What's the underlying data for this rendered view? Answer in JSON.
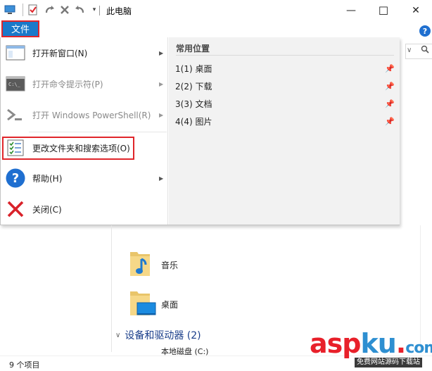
{
  "window": {
    "title": "此电脑",
    "controls": {
      "minimize": "—",
      "maximize": "☐",
      "close": "✕"
    }
  },
  "quick_access": {
    "icons": [
      "computer-icon",
      "properties-icon",
      "redo-icon",
      "delete-icon",
      "undo-icon",
      "customize-dropdown-icon"
    ]
  },
  "ribbon": {
    "file_tab_label": "文件",
    "help_glyph": "?"
  },
  "file_menu": {
    "items": [
      {
        "label": "打开新窗口(N)",
        "icon": "new-window-icon",
        "submenu": true,
        "disabled": false
      },
      {
        "label": "打开命令提示符(P)",
        "icon": "command-prompt-icon",
        "submenu": true,
        "disabled": true
      },
      {
        "label": "打开 Windows PowerShell(R)",
        "icon": "powershell-icon",
        "submenu": true,
        "disabled": true
      },
      {
        "label": "更改文件夹和搜索选项(O)",
        "icon": "folder-options-icon",
        "submenu": false,
        "disabled": false
      },
      {
        "label": "帮助(H)",
        "icon": "help-icon",
        "submenu": true,
        "disabled": false
      },
      {
        "label": "关闭(C)",
        "icon": "close-x-icon",
        "submenu": false,
        "disabled": false
      }
    ],
    "frequent_places": {
      "title": "常用位置",
      "items": [
        {
          "label": "1(1)  桌面",
          "pin": "pin-icon"
        },
        {
          "label": "2(2)  下载",
          "pin": "pin-icon"
        },
        {
          "label": "3(3)  文档",
          "pin": "pin-icon"
        },
        {
          "label": "4(4)  图片",
          "pin": "pin-icon"
        }
      ]
    }
  },
  "content": {
    "folders": [
      {
        "label": "音乐",
        "icon": "music-folder-icon"
      },
      {
        "label": "桌面",
        "icon": "desktop-folder-icon"
      }
    ],
    "section_label": "设备和驱动器 (2)",
    "drive_label": "本地磁盘 (C:)"
  },
  "status": {
    "item_count": "9 个项目"
  },
  "watermark": {
    "brand_asp": "asp",
    "brand_ku": "ku",
    "brand_dot": ".",
    "brand_com": "com",
    "sub": "免费网站源码下载站"
  },
  "colors": {
    "file_tab": "#1979ca",
    "highlight_red": "#e0262b",
    "section_blue": "#1a3e8a"
  }
}
